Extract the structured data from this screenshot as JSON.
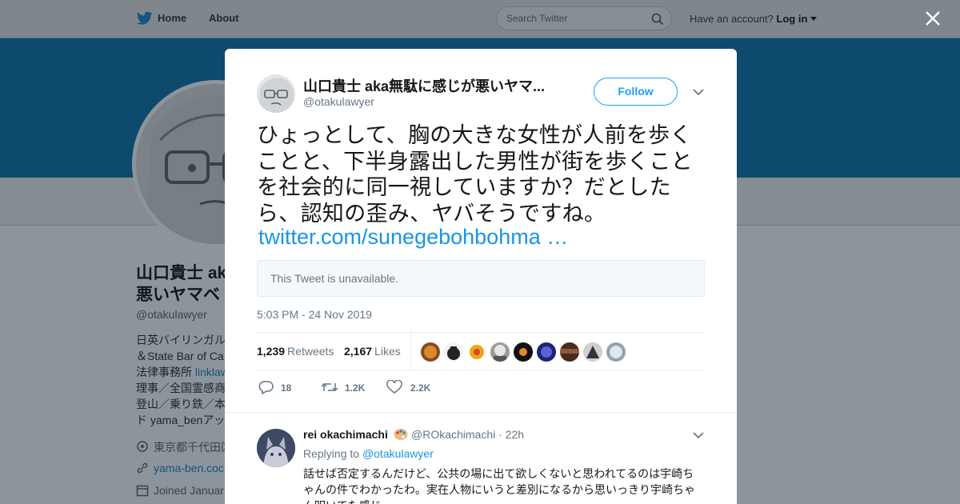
{
  "nav": {
    "home_label": "Home",
    "about_label": "About",
    "search_placeholder": "Search Twitter",
    "account_prompt": "Have an account?",
    "login_label": "Log in"
  },
  "background_profile": {
    "name_line1": "山口貴士 aka",
    "name_line2": "悪いヤマベ",
    "handle": "@otakulawyer",
    "bio": [
      {
        "text": "日英バイリンガル"
      },
      {
        "text": "＆State Bar of Ca"
      },
      {
        "prefix": "法律事務所 ",
        "link": "linklaw"
      },
      {
        "text": "理事／全国霊感商"
      },
      {
        "text": "登山／乗り鉄／本"
      },
      {
        "text": "ド yama_benアッ"
      }
    ],
    "location": "東京都千代田区",
    "website": "yama-ben.coc",
    "joined": "Joined Januar"
  },
  "tweet": {
    "author_name": "山口貴士 aka無駄に感じが悪いヤマ...",
    "author_handle": "@otakulawyer",
    "follow_label": "Follow",
    "text": "ひょっとして、胸の大きな女性が人前を歩くことと、下半身露出した男性が街を歩くことを社会的に同一視していますか？だとしたら、認知の歪み、ヤバそうですね。",
    "link_text": "twitter.com/sunegebohbohma …",
    "quoted_unavailable": "This Tweet is unavailable.",
    "timestamp": "5:03 PM - 24 Nov 2019",
    "retweets_count": "1,239",
    "retweets_label": "Retweets",
    "likes_count": "2,167",
    "likes_label": "Likes",
    "actions": {
      "reply_count": "18",
      "retweet_count": "1.2K",
      "like_count": "2.2K"
    }
  },
  "reply": {
    "name": "rei okachimachi",
    "handle_time": "@ROkachimachi · 22h",
    "replying_prefix": "Replying to",
    "replying_to": "@otakulawyer",
    "text": "話せば否定するんだけど、公共の場に出て欲しくないと思われてるのは宇崎ちゃんの件でわかったわ。実在人物にいうと差別になるから思いっきり宇崎ちゃん叩いてた感じ"
  },
  "colors": {
    "accent": "#1da1f2",
    "link": "#1b95e0",
    "overlay": "#8d959c",
    "banner": "#0d4a6e"
  }
}
